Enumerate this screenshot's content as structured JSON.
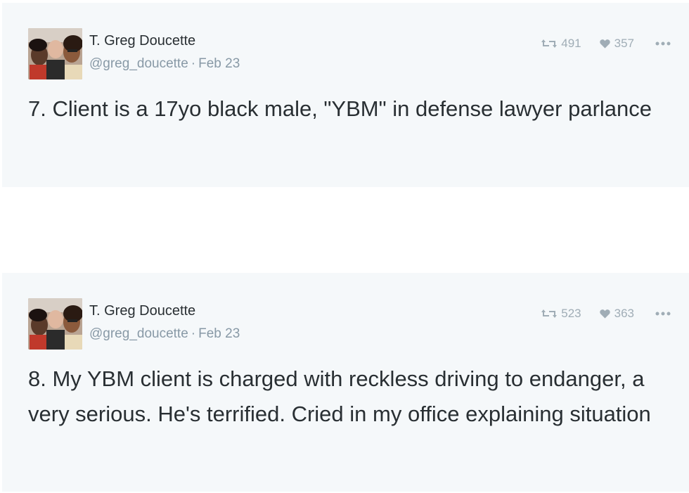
{
  "tweets": [
    {
      "author_name": "T. Greg Doucette",
      "handle": "@greg_doucette",
      "separator": "·",
      "date": "Feb 23",
      "retweets": "491",
      "likes": "357",
      "text": "7. Client is a 17yo black male, \"YBM\" in defense lawyer parlance"
    },
    {
      "author_name": "T. Greg Doucette",
      "handle": "@greg_doucette",
      "separator": "·",
      "date": "Feb 23",
      "retweets": "523",
      "likes": "363",
      "text": "8. My YBM client is charged with reckless driving to endanger, a very serious. He's terrified. Cried in my office explaining situation"
    }
  ],
  "icons": {
    "retweet": "retweet-icon",
    "like": "heart-icon",
    "more": "more-icon"
  },
  "colors": {
    "card_background": "#f5f8fa",
    "text": "#292f33",
    "muted": "#8899a6",
    "action_icon": "#a0adb6"
  }
}
